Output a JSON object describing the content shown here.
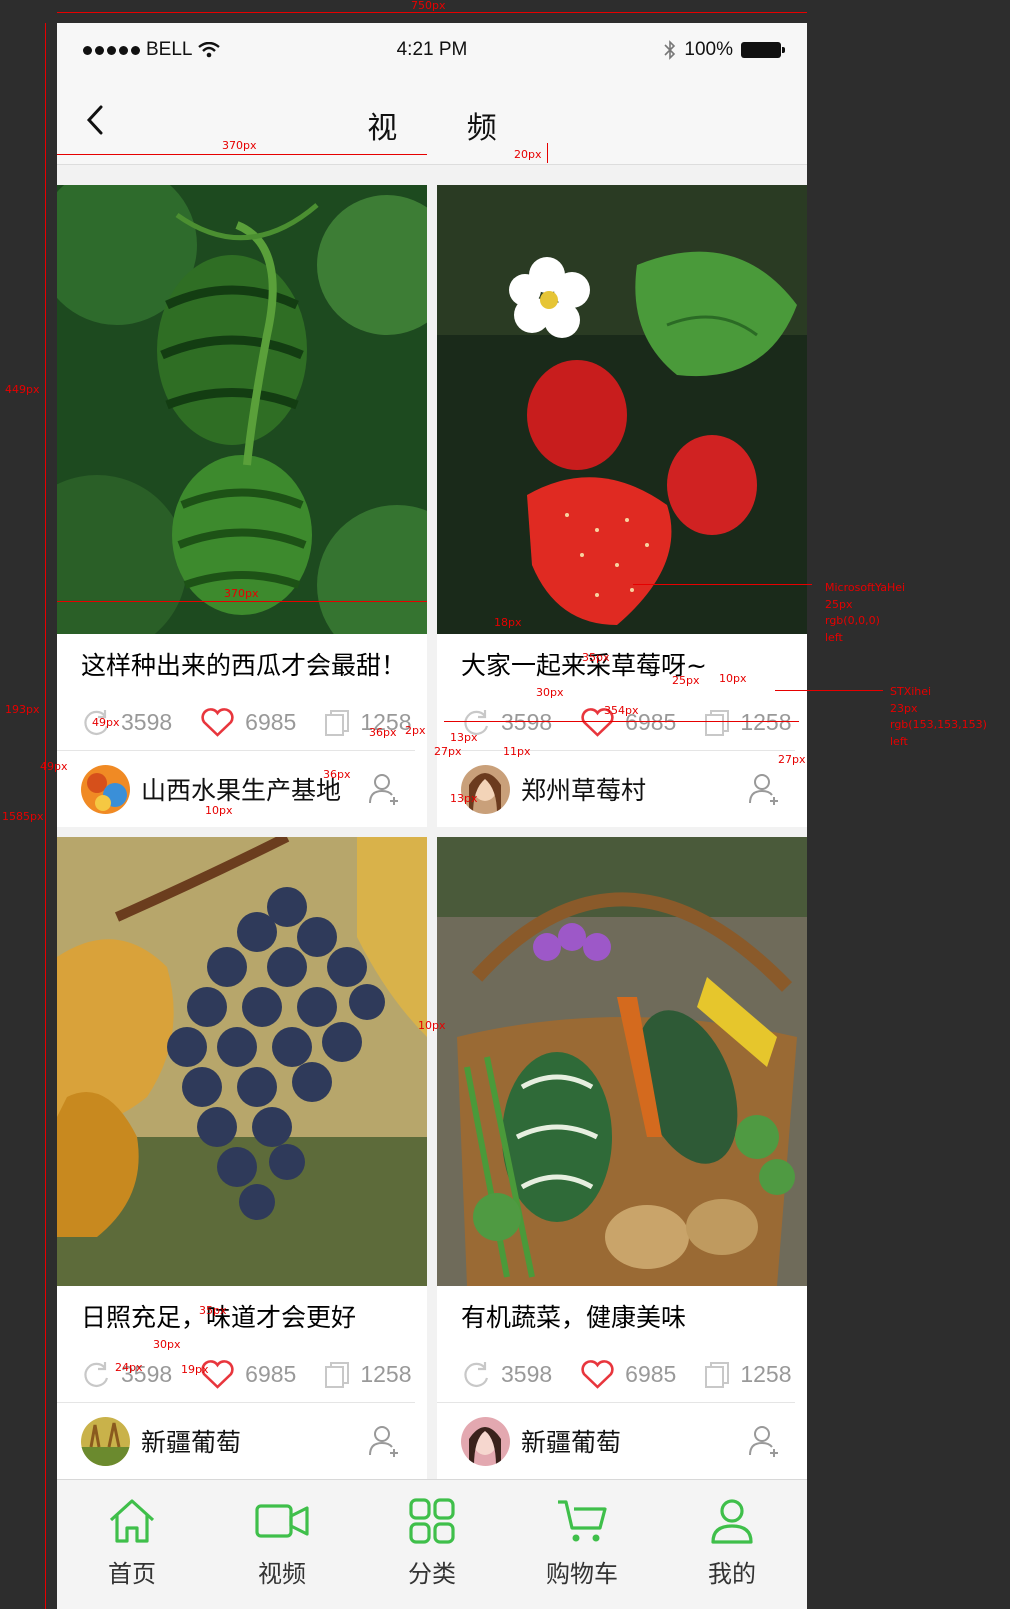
{
  "spec": {
    "width_label": "750px",
    "card_width_label": "370px",
    "gap_label": "20px",
    "image_height_label": "449px",
    "info_height_label": "193px",
    "card_height_label": "1585px",
    "avatar_label": "49px",
    "follow_label": "36px",
    "follow_gap_label": "2px",
    "title_gap_label": "18px",
    "icon_height_label": "30px",
    "icon_width_label": "35px",
    "stat_gap_label": "25px",
    "icon_text_gap_label": "10px",
    "divider_label": "354px",
    "user_pad_label": "13px",
    "user_left_label": "27px",
    "avatar_gap_label": "11px",
    "user_right_label": "27px",
    "user_bottom_label": "13px",
    "row_gap_label": "10px",
    "col_gap_label": "10px",
    "stat_left_label": "24px",
    "stat_bottom_label": "19px",
    "title_font": [
      "MicrosoftYaHei",
      "25px",
      "rgb(0,0,0)",
      "left"
    ],
    "stat_font": [
      "STXihei",
      "23px",
      "rgb(153,153,153)",
      "left"
    ]
  },
  "status": {
    "carrier": "BELL",
    "time": "4:21 PM",
    "battery": "100%"
  },
  "nav": {
    "title": "视 频"
  },
  "cards": [
    {
      "title": "这样种出来的西瓜才会最甜！",
      "shares": "3598",
      "likes": "6985",
      "copies": "1258",
      "user": "山西水果生产基地"
    },
    {
      "title": "大家一起来采草莓呀~",
      "shares": "3598",
      "likes": "6985",
      "copies": "1258",
      "user": "郑州草莓村"
    },
    {
      "title": "日照充足，味道才会更好",
      "shares": "3598",
      "likes": "6985",
      "copies": "1258",
      "user": "新疆葡萄"
    },
    {
      "title": "有机蔬菜，健康美味",
      "shares": "3598",
      "likes": "6985",
      "copies": "1258",
      "user": "新疆葡萄"
    }
  ],
  "tabs": [
    {
      "label": "首页",
      "icon": "home-icon",
      "active": true
    },
    {
      "label": "视频",
      "icon": "video-icon",
      "active": true
    },
    {
      "label": "分类",
      "icon": "grid-icon",
      "active": true
    },
    {
      "label": "购物车",
      "icon": "cart-icon",
      "active": true
    },
    {
      "label": "我的",
      "icon": "user-icon",
      "active": true
    }
  ],
  "colors": {
    "accent": "#3fbf4a",
    "like": "#e8363d",
    "stat_gray": "#999999",
    "annotation": "#e60000"
  }
}
